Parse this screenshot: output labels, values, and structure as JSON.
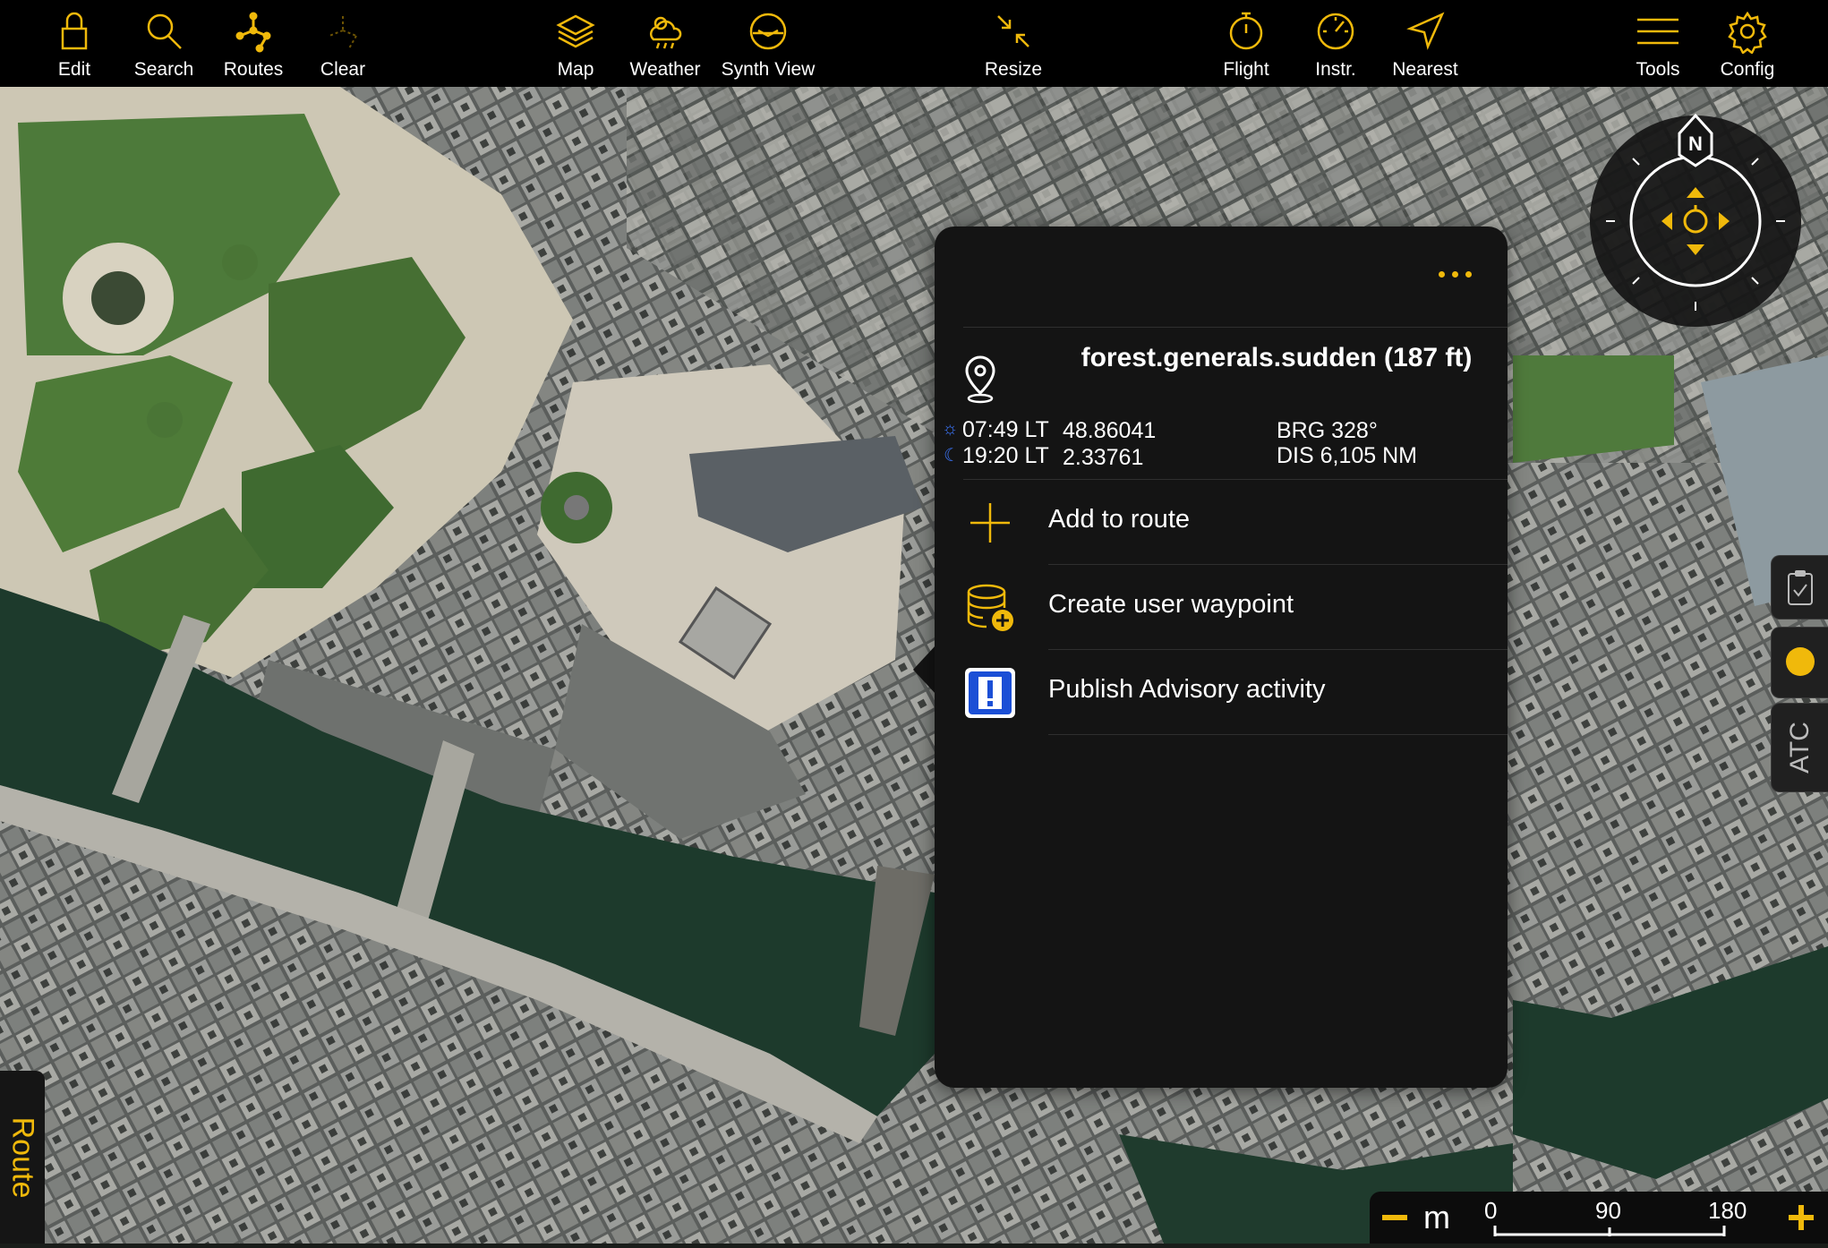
{
  "toolbar": {
    "edit": "Edit",
    "search": "Search",
    "routes": "Routes",
    "clear": "Clear",
    "map": "Map",
    "weather": "Weather",
    "synth_view": "Synth View",
    "resize": "Resize",
    "flight": "Flight",
    "instr": "Instr.",
    "nearest": "Nearest",
    "tools": "Tools",
    "config": "Config"
  },
  "popup": {
    "title": "forest.generals.sudden (187 ft)",
    "sunrise": "07:49 LT",
    "sunset": "19:20 LT",
    "lat": "48.86041",
    "lon": "2.33761",
    "bearing": "BRG 328°",
    "distance": "DIS 6,105 NM",
    "actions": [
      {
        "label": "Add to route",
        "icon": "plus-icon"
      },
      {
        "label": "Create user waypoint",
        "icon": "database-add-icon"
      },
      {
        "label": "Publish Advisory activity",
        "icon": "advisory-icon"
      }
    ]
  },
  "compass": {
    "north": "N"
  },
  "side_tabs": {
    "atc": "ATC"
  },
  "route_tab": {
    "label": "Route"
  },
  "scale": {
    "unit": "m",
    "ticks": [
      "0",
      "90",
      "180"
    ]
  },
  "colors": {
    "accent": "#f0b90b",
    "panel": "#141414",
    "toolbar": "#000000",
    "river": "#1d3a2c"
  }
}
